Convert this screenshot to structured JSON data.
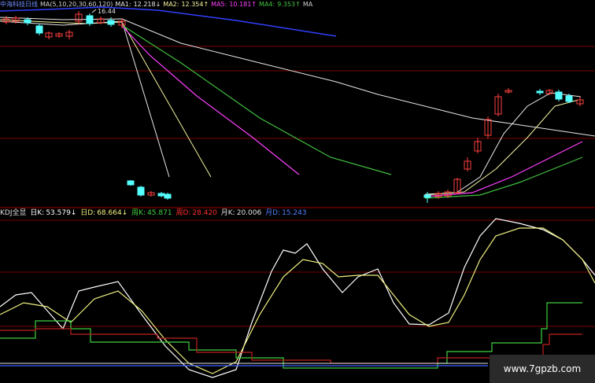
{
  "header": {
    "stock_name": "中海科技日线",
    "ma_params": "MA(5,10,20,30,60,120)",
    "ma1_label": "MA1:",
    "ma1_value": "12.218↓",
    "ma2_label": "MA2:",
    "ma2_value": "12.354↑",
    "ma5_label": "MA5:",
    "ma5_value": "10.181↑",
    "ma4_label": "MA4:",
    "ma4_value": "9.353↑",
    "ma_tail": "MA",
    "high_marker": "16.44"
  },
  "indicator": {
    "name": "KDJ全显",
    "day_k_label": "日K:",
    "day_k_value": "53.579↓",
    "day_d_label": "日D:",
    "day_d_value": "68.664↓",
    "week_k_label": "周K:",
    "week_k_value": "45.871",
    "week_d_label": "周D:",
    "week_d_value": "28.420",
    "month_k_label": "月K:",
    "month_k_value": "20.006",
    "month_d_label": "月D:",
    "month_d_value": "15.243"
  },
  "watermark": "www.7gpzb.com",
  "colors": {
    "background": "#000000",
    "up_candle": "#ff4040",
    "down_candle": "#54ffff",
    "ma1": "#e8e8e8",
    "ma2": "#f4f4a0",
    "ma3": "#ff40ff",
    "ma4": "#40c040",
    "ma6": "#3040ff",
    "kdj_k": "#ffffff",
    "kdj_d": "#f0f080",
    "week": "#40d040",
    "month": "#c02020",
    "grid": "#7a0000"
  },
  "chart_data": [
    {
      "type": "candlestick",
      "title": "中海科技日线",
      "series": [
        {
          "name": "MA1",
          "last_value": 12.218
        },
        {
          "name": "MA2",
          "last_value": 12.354
        },
        {
          "name": "MA5",
          "last_value": 10.181
        },
        {
          "name": "MA4",
          "last_value": 9.353
        }
      ],
      "annotations": [
        "16.44"
      ],
      "grid": true
    },
    {
      "type": "line",
      "title": "KDJ全显",
      "series": [
        {
          "name": "日K",
          "last_value": 53.579
        },
        {
          "name": "日D",
          "last_value": 68.664
        },
        {
          "name": "周K",
          "last_value": 45.871
        },
        {
          "name": "周D",
          "last_value": 28.42
        },
        {
          "name": "月K",
          "last_value": 20.006
        },
        {
          "name": "月D",
          "last_value": 15.243
        }
      ],
      "grid": true
    }
  ]
}
